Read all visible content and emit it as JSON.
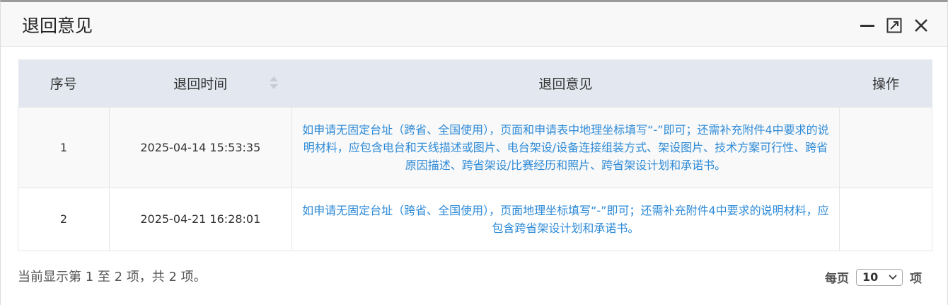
{
  "dialog": {
    "title": "退回意见",
    "icons": {
      "minimize": "minimize-icon",
      "maximize": "maximize-icon",
      "close": "close-icon"
    }
  },
  "table": {
    "columns": [
      "序号",
      "退回时间",
      "退回意见",
      "操作"
    ],
    "rows": [
      {
        "index": "1",
        "time": "2025-04-14 15:53:35",
        "opinion": "如申请无固定台址（跨省、全国使用），页面和申请表中地理坐标填写“-”即可；还需补充附件4中要求的说明材料，应包含电台和天线描述或图片、电台架设/设备连接组装方式、架设图片、技术方案可行性、跨省原因描述、跨省架设/比赛经历和照片、跨省架设计划和承诺书。",
        "action": ""
      },
      {
        "index": "2",
        "time": "2025-04-21 16:28:01",
        "opinion": "如申请无固定台址（跨省、全国使用），页面地理坐标填写“-”即可；还需补充附件4中要求的说明材料，应包含跨省架设计划和承诺书。",
        "action": ""
      }
    ]
  },
  "footer": {
    "info": "当前显示第 1 至 2 项，共 2 项。",
    "per_page_label": "每页",
    "per_page_value": "10",
    "per_page_suffix": "项"
  }
}
